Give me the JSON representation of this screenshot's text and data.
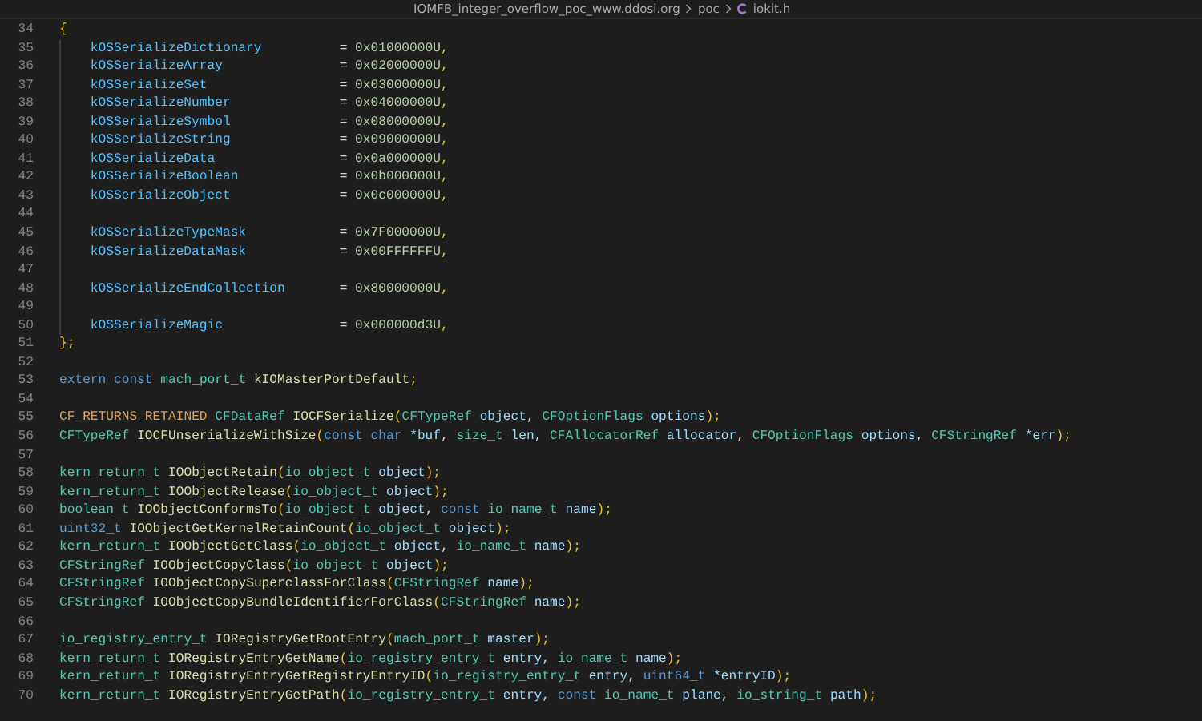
{
  "breadcrumbs": [
    {
      "label": "IOMFB_integer_overflow_poc_www.ddosi.org",
      "kind": "folder"
    },
    {
      "label": "poc",
      "kind": "folder"
    },
    {
      "label": "iokit.h",
      "kind": "c-file"
    }
  ],
  "lines": [
    {
      "number": "34",
      "tokens": [
        {
          "text": "{",
          "kind": "bracket"
        }
      ]
    },
    {
      "number": "35",
      "indented": true,
      "tokens": [
        {
          "text": "kOSSerializeDictionary",
          "kind": "member"
        },
        {
          "text": "= ",
          "kind": "plain"
        },
        {
          "text": "0x01000000U",
          "kind": "number"
        },
        {
          "text": ",",
          "kind": "bracket"
        }
      ]
    },
    {
      "number": "36",
      "indented": true,
      "tokens": [
        {
          "text": "kOSSerializeArray",
          "kind": "member"
        },
        {
          "text": "= ",
          "kind": "plain"
        },
        {
          "text": "0x02000000U",
          "kind": "number"
        },
        {
          "text": ",",
          "kind": "bracket"
        }
      ]
    },
    {
      "number": "37",
      "indented": true,
      "tokens": [
        {
          "text": "kOSSerializeSet",
          "kind": "member"
        },
        {
          "text": "= ",
          "kind": "plain"
        },
        {
          "text": "0x03000000U",
          "kind": "number"
        },
        {
          "text": ",",
          "kind": "bracket"
        }
      ]
    },
    {
      "number": "38",
      "indented": true,
      "tokens": [
        {
          "text": "kOSSerializeNumber",
          "kind": "member"
        },
        {
          "text": "= ",
          "kind": "plain"
        },
        {
          "text": "0x04000000U",
          "kind": "number"
        },
        {
          "text": ",",
          "kind": "bracket"
        }
      ]
    },
    {
      "number": "39",
      "indented": true,
      "tokens": [
        {
          "text": "kOSSerializeSymbol",
          "kind": "member"
        },
        {
          "text": "= ",
          "kind": "plain"
        },
        {
          "text": "0x08000000U",
          "kind": "number"
        },
        {
          "text": ",",
          "kind": "bracket"
        }
      ]
    },
    {
      "number": "40",
      "indented": true,
      "tokens": [
        {
          "text": "kOSSerializeString",
          "kind": "member"
        },
        {
          "text": "= ",
          "kind": "plain"
        },
        {
          "text": "0x09000000U",
          "kind": "number"
        },
        {
          "text": ",",
          "kind": "bracket"
        }
      ]
    },
    {
      "number": "41",
      "indented": true,
      "tokens": [
        {
          "text": "kOSSerializeData",
          "kind": "member"
        },
        {
          "text": "= ",
          "kind": "plain"
        },
        {
          "text": "0x0a000000U",
          "kind": "number"
        },
        {
          "text": ",",
          "kind": "bracket"
        }
      ]
    },
    {
      "number": "42",
      "indented": true,
      "tokens": [
        {
          "text": "kOSSerializeBoolean",
          "kind": "member"
        },
        {
          "text": "= ",
          "kind": "plain"
        },
        {
          "text": "0x0b000000U",
          "kind": "number"
        },
        {
          "text": ",",
          "kind": "bracket"
        }
      ]
    },
    {
      "number": "43",
      "indented": true,
      "tokens": [
        {
          "text": "kOSSerializeObject",
          "kind": "member"
        },
        {
          "text": "= ",
          "kind": "plain"
        },
        {
          "text": "0x0c000000U",
          "kind": "number"
        },
        {
          "text": ",",
          "kind": "bracket"
        }
      ]
    },
    {
      "number": "44",
      "indented": true
    },
    {
      "number": "45",
      "indented": true,
      "tokens": [
        {
          "text": "kOSSerializeTypeMask",
          "kind": "member"
        },
        {
          "text": "= ",
          "kind": "plain"
        },
        {
          "text": "0x7F000000U",
          "kind": "number"
        },
        {
          "text": ",",
          "kind": "bracket"
        }
      ]
    },
    {
      "number": "46",
      "indented": true,
      "tokens": [
        {
          "text": "kOSSerializeDataMask",
          "kind": "member"
        },
        {
          "text": "= ",
          "kind": "plain"
        },
        {
          "text": "0x00FFFFFFU",
          "kind": "number"
        },
        {
          "text": ",",
          "kind": "bracket"
        }
      ]
    },
    {
      "number": "47",
      "indented": true
    },
    {
      "number": "48",
      "indented": true,
      "tokens": [
        {
          "text": "kOSSerializeEndCollection",
          "kind": "member"
        },
        {
          "text": "= ",
          "kind": "plain"
        },
        {
          "text": "0x80000000U",
          "kind": "number"
        },
        {
          "text": ",",
          "kind": "bracket"
        }
      ]
    },
    {
      "number": "49",
      "indented": true
    },
    {
      "number": "50",
      "indented": true,
      "tokens": [
        {
          "text": "kOSSerializeMagic",
          "kind": "member"
        },
        {
          "text": "= ",
          "kind": "plain"
        },
        {
          "text": "0x000000d3U",
          "kind": "number"
        },
        {
          "text": ",",
          "kind": "bracket"
        }
      ]
    },
    {
      "number": "51",
      "tokens": [
        {
          "text": "};",
          "kind": "bracket"
        }
      ]
    },
    {
      "number": "52"
    },
    {
      "number": "53",
      "tokens": [
        {
          "text": "extern const ",
          "kind": "keyword"
        },
        {
          "text": "mach_port_t ",
          "kind": "type"
        },
        {
          "text": "kIOMasterPortDefault",
          "kind": "function"
        },
        {
          "text": ";",
          "kind": "bracket"
        }
      ]
    },
    {
      "number": "54"
    },
    {
      "number": "55",
      "tokens": [
        {
          "text": "CF_RETURNS_RETAINED ",
          "kind": "macro"
        },
        {
          "text": "CFDataRef ",
          "kind": "type"
        },
        {
          "text": "IOCFSerialize",
          "kind": "function"
        },
        {
          "text": "(",
          "kind": "bracket"
        },
        {
          "text": "CFTypeRef ",
          "kind": "type"
        },
        {
          "text": "object",
          "kind": "variable"
        },
        {
          "text": ", ",
          "kind": "plain"
        },
        {
          "text": "CFOptionFlags ",
          "kind": "type"
        },
        {
          "text": "options",
          "kind": "variable"
        },
        {
          "text": ");",
          "kind": "bracket"
        }
      ]
    },
    {
      "number": "56",
      "tokens": [
        {
          "text": "CFTypeRef ",
          "kind": "type"
        },
        {
          "text": "IOCFUnserializeWithSize",
          "kind": "function"
        },
        {
          "text": "(",
          "kind": "bracket"
        },
        {
          "text": "const char ",
          "kind": "keyword"
        },
        {
          "text": "*buf",
          "kind": "variable"
        },
        {
          "text": ", ",
          "kind": "plain"
        },
        {
          "text": "size_t ",
          "kind": "type"
        },
        {
          "text": "len",
          "kind": "variable"
        },
        {
          "text": ", ",
          "kind": "plain"
        },
        {
          "text": "CFAllocatorRef ",
          "kind": "type"
        },
        {
          "text": "allocator",
          "kind": "variable"
        },
        {
          "text": ", ",
          "kind": "plain"
        },
        {
          "text": "CFOptionFlags ",
          "kind": "type"
        },
        {
          "text": "options",
          "kind": "variable"
        },
        {
          "text": ", ",
          "kind": "plain"
        },
        {
          "text": "CFStringRef ",
          "kind": "type"
        },
        {
          "text": "*err",
          "kind": "variable"
        },
        {
          "text": ");",
          "kind": "bracket"
        }
      ]
    },
    {
      "number": "57"
    },
    {
      "number": "58",
      "tokens": [
        {
          "text": "kern_return_t ",
          "kind": "type"
        },
        {
          "text": "IOObjectRetain",
          "kind": "function"
        },
        {
          "text": "(",
          "kind": "bracket"
        },
        {
          "text": "io_object_t ",
          "kind": "type"
        },
        {
          "text": "object",
          "kind": "variable"
        },
        {
          "text": ");",
          "kind": "bracket"
        }
      ]
    },
    {
      "number": "59",
      "tokens": [
        {
          "text": "kern_return_t ",
          "kind": "type"
        },
        {
          "text": "IOObjectRelease",
          "kind": "function"
        },
        {
          "text": "(",
          "kind": "bracket"
        },
        {
          "text": "io_object_t ",
          "kind": "type"
        },
        {
          "text": "object",
          "kind": "variable"
        },
        {
          "text": ");",
          "kind": "bracket"
        }
      ]
    },
    {
      "number": "60",
      "tokens": [
        {
          "text": "boolean_t ",
          "kind": "type"
        },
        {
          "text": "IOObjectConformsTo",
          "kind": "function"
        },
        {
          "text": "(",
          "kind": "bracket"
        },
        {
          "text": "io_object_t ",
          "kind": "type"
        },
        {
          "text": "object",
          "kind": "variable"
        },
        {
          "text": ", ",
          "kind": "plain"
        },
        {
          "text": "const ",
          "kind": "keyword"
        },
        {
          "text": "io_name_t ",
          "kind": "type"
        },
        {
          "text": "name",
          "kind": "variable"
        },
        {
          "text": ");",
          "kind": "bracket"
        }
      ]
    },
    {
      "number": "61",
      "tokens": [
        {
          "text": "uint32_t ",
          "kind": "keyword"
        },
        {
          "text": "IOObjectGetKernelRetainCount",
          "kind": "function"
        },
        {
          "text": "(",
          "kind": "bracket"
        },
        {
          "text": "io_object_t ",
          "kind": "type"
        },
        {
          "text": "object",
          "kind": "variable"
        },
        {
          "text": ");",
          "kind": "bracket"
        }
      ]
    },
    {
      "number": "62",
      "tokens": [
        {
          "text": "kern_return_t ",
          "kind": "type"
        },
        {
          "text": "IOObjectGetClass",
          "kind": "function"
        },
        {
          "text": "(",
          "kind": "bracket"
        },
        {
          "text": "io_object_t ",
          "kind": "type"
        },
        {
          "text": "object",
          "kind": "variable"
        },
        {
          "text": ", ",
          "kind": "plain"
        },
        {
          "text": "io_name_t ",
          "kind": "type"
        },
        {
          "text": "name",
          "kind": "variable"
        },
        {
          "text": ");",
          "kind": "bracket"
        }
      ]
    },
    {
      "number": "63",
      "tokens": [
        {
          "text": "CFStringRef ",
          "kind": "type"
        },
        {
          "text": "IOObjectCopyClass",
          "kind": "function"
        },
        {
          "text": "(",
          "kind": "bracket"
        },
        {
          "text": "io_object_t ",
          "kind": "type"
        },
        {
          "text": "object",
          "kind": "variable"
        },
        {
          "text": ");",
          "kind": "bracket"
        }
      ]
    },
    {
      "number": "64",
      "tokens": [
        {
          "text": "CFStringRef ",
          "kind": "type"
        },
        {
          "text": "IOObjectCopySuperclassForClass",
          "kind": "function"
        },
        {
          "text": "(",
          "kind": "bracket"
        },
        {
          "text": "CFStringRef ",
          "kind": "type"
        },
        {
          "text": "name",
          "kind": "variable"
        },
        {
          "text": ");",
          "kind": "bracket"
        }
      ]
    },
    {
      "number": "65",
      "tokens": [
        {
          "text": "CFStringRef ",
          "kind": "type"
        },
        {
          "text": "IOObjectCopyBundleIdentifierForClass",
          "kind": "function"
        },
        {
          "text": "(",
          "kind": "bracket"
        },
        {
          "text": "CFStringRef ",
          "kind": "type"
        },
        {
          "text": "name",
          "kind": "variable"
        },
        {
          "text": ");",
          "kind": "bracket"
        }
      ]
    },
    {
      "number": "66"
    },
    {
      "number": "67",
      "tokens": [
        {
          "text": "io_registry_entry_t ",
          "kind": "type"
        },
        {
          "text": "IORegistryGetRootEntry",
          "kind": "function"
        },
        {
          "text": "(",
          "kind": "bracket"
        },
        {
          "text": "mach_port_t ",
          "kind": "type"
        },
        {
          "text": "master",
          "kind": "variable"
        },
        {
          "text": ");",
          "kind": "bracket"
        }
      ]
    },
    {
      "number": "68",
      "tokens": [
        {
          "text": "kern_return_t ",
          "kind": "type"
        },
        {
          "text": "IORegistryEntryGetName",
          "kind": "function"
        },
        {
          "text": "(",
          "kind": "bracket"
        },
        {
          "text": "io_registry_entry_t ",
          "kind": "type"
        },
        {
          "text": "entry",
          "kind": "variable"
        },
        {
          "text": ", ",
          "kind": "plain"
        },
        {
          "text": "io_name_t ",
          "kind": "type"
        },
        {
          "text": "name",
          "kind": "variable"
        },
        {
          "text": ");",
          "kind": "bracket"
        }
      ]
    },
    {
      "number": "69",
      "tokens": [
        {
          "text": "kern_return_t ",
          "kind": "type"
        },
        {
          "text": "IORegistryEntryGetRegistryEntryID",
          "kind": "function"
        },
        {
          "text": "(",
          "kind": "bracket"
        },
        {
          "text": "io_registry_entry_t ",
          "kind": "type"
        },
        {
          "text": "entry",
          "kind": "variable"
        },
        {
          "text": ", ",
          "kind": "plain"
        },
        {
          "text": "uint64_t ",
          "kind": "keyword"
        },
        {
          "text": "*entryID",
          "kind": "variable"
        },
        {
          "text": ");",
          "kind": "bracket"
        }
      ]
    },
    {
      "number": "70",
      "tokens": [
        {
          "text": "kern_return_t ",
          "kind": "type"
        },
        {
          "text": "IORegistryEntryGetPath",
          "kind": "function"
        },
        {
          "text": "(",
          "kind": "bracket"
        },
        {
          "text": "io_registry_entry_t ",
          "kind": "type"
        },
        {
          "text": "entry",
          "kind": "variable"
        },
        {
          "text": ", ",
          "kind": "plain"
        },
        {
          "text": "const ",
          "kind": "keyword"
        },
        {
          "text": "io_name_t ",
          "kind": "type"
        },
        {
          "text": "plane",
          "kind": "variable"
        },
        {
          "text": ", ",
          "kind": "plain"
        },
        {
          "text": "io_string_t ",
          "kind": "type"
        },
        {
          "text": "path",
          "kind": "variable"
        },
        {
          "text": ");",
          "kind": "bracket"
        }
      ]
    }
  ]
}
